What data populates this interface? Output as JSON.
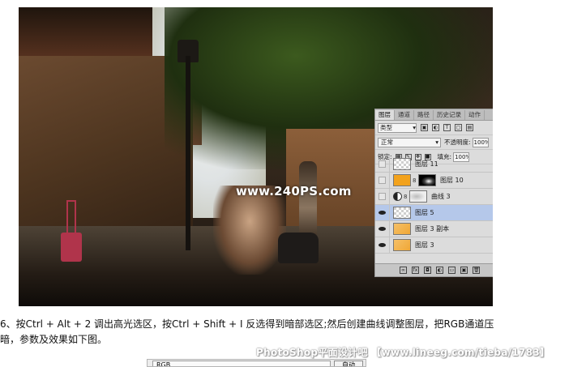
{
  "photo": {
    "watermark": "www.240PS.com"
  },
  "layers_panel": {
    "tabs": [
      "图层",
      "通道",
      "路径",
      "历史记录",
      "动作"
    ],
    "filter_label": "类型",
    "blend_mode": "正常",
    "opacity_label": "不透明度:",
    "opacity_value": "100%",
    "lock_label": "锁定:",
    "fill_label": "填充:",
    "fill_value": "100%",
    "layers": [
      {
        "name": "图层 11",
        "visible": false,
        "thumb": "checker"
      },
      {
        "name": "图层 10",
        "visible": false,
        "thumb": "orange"
      },
      {
        "name": "曲线 3",
        "visible": false,
        "thumb": "adjustment"
      },
      {
        "name": "图层 5",
        "visible": true,
        "thumb": "checker",
        "selected": true
      },
      {
        "name": "图层 3 副本",
        "visible": true,
        "thumb": "orange-checker"
      },
      {
        "name": "图层 3",
        "visible": true,
        "thumb": "orange-checker"
      }
    ]
  },
  "caption": {
    "text": "6、按Ctrl + Alt + 2 调出高光选区，按Ctrl + Shift + I 反选得到暗部选区;然后创建曲线调整图层，把RGB通道压暗，参数及效果如下图。"
  },
  "forum_watermark": "PhotoShop平面设计吧 【www.lineeg.com/tieba/1783】",
  "curves_dialog": {
    "channel": "RGB",
    "auto_label": "自动"
  }
}
